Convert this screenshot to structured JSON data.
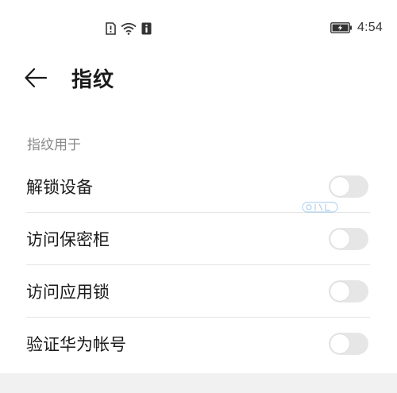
{
  "status_bar": {
    "time": "4:54",
    "icons": [
      "sim-icon",
      "wifi-icon",
      "info-icon",
      "battery-charging-icon"
    ]
  },
  "app_bar": {
    "back_icon": "arrow-left-icon",
    "title": "指纹"
  },
  "section": {
    "header": "指纹用于"
  },
  "settings": [
    {
      "label": "解锁设备",
      "enabled": false
    },
    {
      "label": "访问保密柜",
      "enabled": false
    },
    {
      "label": "访问应用锁",
      "enabled": false
    },
    {
      "label": "验证华为帐号",
      "enabled": false
    }
  ],
  "colors": {
    "toggle_off": "#e6e6e6",
    "text_primary": "#1a1a1a",
    "text_secondary": "#8a8a8a",
    "divider": "#e4e4e4"
  }
}
